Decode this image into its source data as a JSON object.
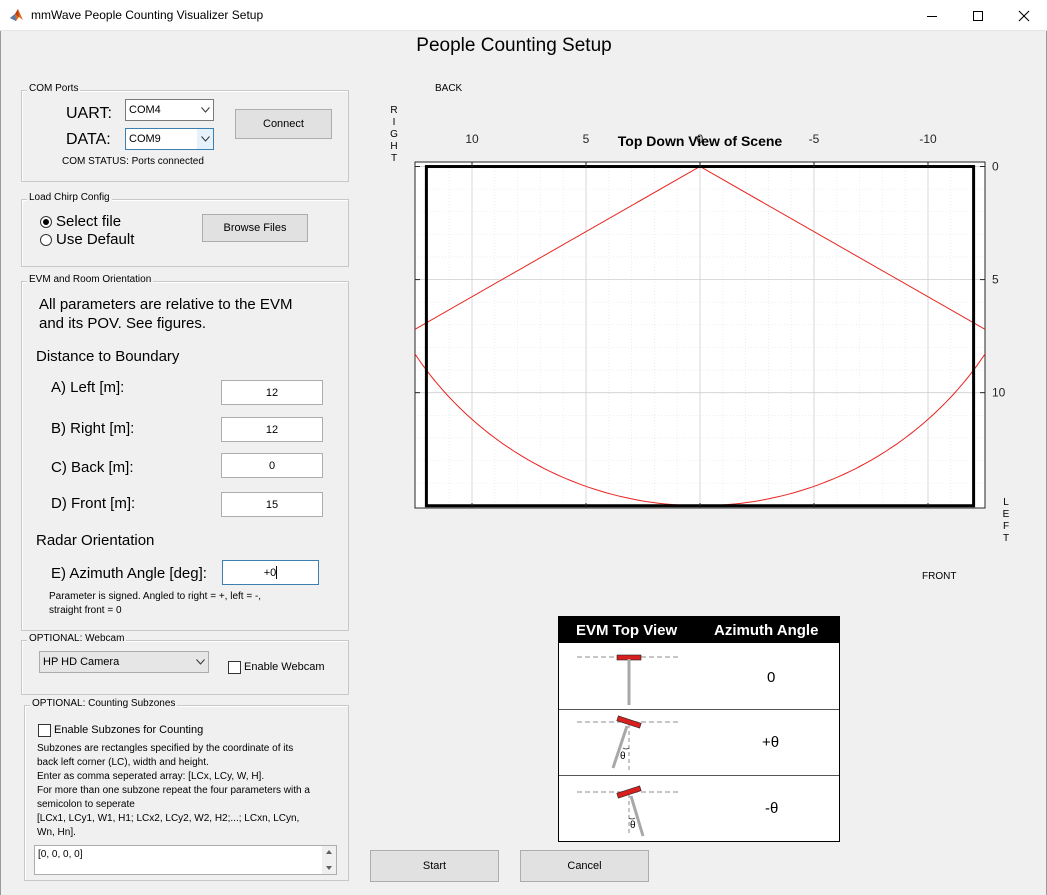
{
  "window": {
    "title": "mmWave People Counting Visualizer Setup",
    "minimize_glyph": "—",
    "maximize_glyph": "☐",
    "close_glyph": "✕"
  },
  "page_title": "People Counting Setup",
  "com_ports": {
    "title": "COM Ports",
    "uart_label": "UART:",
    "uart_value": "COM4",
    "data_label": "DATA:",
    "data_value": "COM9",
    "connect_label": "Connect",
    "status": "COM STATUS: Ports connected"
  },
  "chirp": {
    "title": "Load Chirp Config",
    "select_file": "Select file",
    "use_default": "Use Default",
    "browse_label": "Browse Files",
    "selected": "select_file"
  },
  "evm": {
    "title": "EVM and Room Orientation",
    "intro_line1": "All parameters are relative to the EVM",
    "intro_line2": "and its POV.  See figures.",
    "distance_heading": "Distance to Boundary",
    "left_label": "A) Left [m]:",
    "left_value": "12",
    "right_label": "B) Right [m]:",
    "right_value": "12",
    "back_label": "C) Back [m]:",
    "back_value": "0",
    "front_label": "D) Front [m]:",
    "front_value": "15",
    "radar_heading": "Radar Orientation",
    "azimuth_label": "E) Azimuth Angle [deg]:",
    "azimuth_value": "+0",
    "note_line1": "Parameter is signed. Angled to right = +, left = -,",
    "note_line2": "straight front = 0"
  },
  "webcam": {
    "title": "OPTIONAL: Webcam",
    "camera_value": "HP HD Camera",
    "enable_label": "Enable Webcam",
    "enabled": false
  },
  "subzones": {
    "title": "OPTIONAL: Counting Subzones",
    "enable_label": "Enable Subzones for Counting",
    "enabled": false,
    "desc_lines": [
      "Subzones are rectangles specified by the coordinate of its",
      "back left corner (LC), width and height.",
      "Enter as comma seperated array: [LCx, LCy, W, H].",
      "For more than one subzone repeat the four parameters with a",
      "semicolon to seperate",
      "[LCx1, LCy1, W1, H1; LCx2, LCy2, W2, H2;...; LCxn, LCyn,",
      "Wn, Hn]."
    ],
    "input_value": "[0, 0, 0, 0]"
  },
  "plot_labels": {
    "back": "BACK",
    "front": "FRONT",
    "right": "RIGHT",
    "left": "LEFT"
  },
  "chart_data": {
    "type": "line",
    "title": "Top Down View of Scene",
    "x_axis": {
      "reversed": true,
      "ticks": [
        10,
        5,
        0,
        -5,
        -10
      ],
      "tick_labels": [
        "10",
        "5",
        "0",
        "-5",
        "-10"
      ],
      "location": "top",
      "range": [
        12.5,
        -12.5
      ]
    },
    "y_axis": {
      "reversed": true,
      "ticks": [
        0,
        5,
        10
      ],
      "tick_labels": [
        "0",
        "5",
        "10"
      ],
      "location": "right",
      "range": [
        -0.2,
        15.1
      ]
    },
    "grid": "major and minor, dotted",
    "boundary_box": {
      "x": [
        12,
        -12
      ],
      "y": [
        0,
        15
      ],
      "color": "#000000"
    },
    "series": [
      {
        "points": [
          [
            12.5,
            7.2
          ],
          [
            0,
            0
          ],
          [
            -12.5,
            7.2
          ]
        ],
        "color": "#e8231f"
      },
      {
        "arc_center": [
          0,
          0
        ],
        "arc_radius": 15,
        "color": "#e8231f"
      }
    ]
  },
  "azimuth_table": {
    "col1": "EVM Top View",
    "col2": "Azimuth Angle",
    "rows": [
      {
        "value": "0",
        "figure_label": ""
      },
      {
        "value": "+θ",
        "figure_label": "θ"
      },
      {
        "value": "-θ",
        "figure_label": "θ"
      }
    ]
  },
  "actions": {
    "start_label": "Start",
    "cancel_label": "Cancel"
  },
  "colors": {
    "window_bg": "#f0f0f0",
    "button_bg": "#e1e1e1",
    "radar_red": "#e8231f",
    "evm_red": "#d8201e"
  }
}
